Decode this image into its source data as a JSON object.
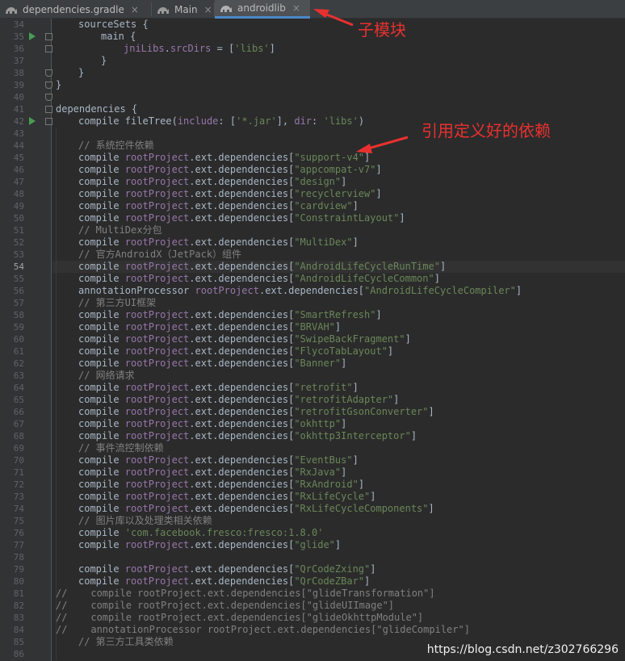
{
  "tabs": [
    {
      "label": "dependencies.gradle",
      "close": "×",
      "active": false
    },
    {
      "label": "Main",
      "close": "×",
      "active": false
    },
    {
      "label": "androidlib",
      "close": "×",
      "active": true
    }
  ],
  "gutter": {
    "line_numbers": [
      "34",
      "35",
      "36",
      "37",
      "38",
      "39",
      "40",
      "41",
      "42",
      "43",
      "44",
      "45",
      "46",
      "47",
      "48",
      "49",
      "50",
      "51",
      "52",
      "53",
      "54",
      "55",
      "56",
      "57",
      "58",
      "59",
      "60",
      "61",
      "62",
      "63",
      "64",
      "65",
      "66",
      "67",
      "68",
      "69",
      "70",
      "71",
      "72",
      "73",
      "74",
      "75",
      "76",
      "77",
      "78",
      "79",
      "80",
      "81",
      "82",
      "83",
      "84",
      "85",
      "86"
    ],
    "current_line": "54"
  },
  "code": [
    {
      "indent": 1,
      "parts": [
        [
          "idc",
          "sourceSets {"
        ]
      ]
    },
    {
      "indent": 2,
      "parts": [
        [
          "idc",
          "main {"
        ]
      ]
    },
    {
      "indent": 3,
      "parts": [
        [
          "prop",
          "jniLibs"
        ],
        [
          "idc",
          "."
        ],
        [
          "prop",
          "srcDirs"
        ],
        [
          "idc",
          " = ["
        ],
        [
          "str",
          "'libs'"
        ],
        [
          "idc",
          "]"
        ]
      ]
    },
    {
      "indent": 2,
      "parts": [
        [
          "idc",
          "}"
        ]
      ]
    },
    {
      "indent": 1,
      "parts": [
        [
          "idc",
          "}"
        ]
      ]
    },
    {
      "indent": 0,
      "parts": [
        [
          "idc",
          "}"
        ]
      ]
    },
    {
      "indent": 0,
      "parts": []
    },
    {
      "indent": 0,
      "parts": [
        [
          "idc",
          "dependencies {"
        ]
      ]
    },
    {
      "indent": 1,
      "parts": [
        [
          "idc",
          "compile fileTree("
        ],
        [
          "prop",
          "include"
        ],
        [
          "idc",
          ": ["
        ],
        [
          "str",
          "'*.jar'"
        ],
        [
          "idc",
          "], "
        ],
        [
          "prop",
          "dir"
        ],
        [
          "idc",
          ": "
        ],
        [
          "str",
          "'libs'"
        ],
        [
          "idc",
          ")"
        ]
      ]
    },
    {
      "indent": 0,
      "parts": []
    },
    {
      "indent": 1,
      "parts": [
        [
          "cmt",
          "// 系统控件依赖"
        ]
      ]
    },
    {
      "indent": 1,
      "parts": [
        [
          "idc",
          "compile "
        ],
        [
          "prop",
          "rootProject"
        ],
        [
          "idc",
          ".ext.dependencies["
        ],
        [
          "str",
          "\"support-v4\""
        ],
        [
          "idc",
          "]"
        ]
      ]
    },
    {
      "indent": 1,
      "parts": [
        [
          "idc",
          "compile "
        ],
        [
          "prop",
          "rootProject"
        ],
        [
          "idc",
          ".ext.dependencies["
        ],
        [
          "str",
          "\"appcompat-v7\""
        ],
        [
          "idc",
          "]"
        ]
      ]
    },
    {
      "indent": 1,
      "parts": [
        [
          "idc",
          "compile "
        ],
        [
          "prop",
          "rootProject"
        ],
        [
          "idc",
          ".ext.dependencies["
        ],
        [
          "str",
          "\"design\""
        ],
        [
          "idc",
          "]"
        ]
      ]
    },
    {
      "indent": 1,
      "parts": [
        [
          "idc",
          "compile "
        ],
        [
          "prop",
          "rootProject"
        ],
        [
          "idc",
          ".ext.dependencies["
        ],
        [
          "str",
          "\"recyclerview\""
        ],
        [
          "idc",
          "]"
        ]
      ]
    },
    {
      "indent": 1,
      "parts": [
        [
          "idc",
          "compile "
        ],
        [
          "prop",
          "rootProject"
        ],
        [
          "idc",
          ".ext.dependencies["
        ],
        [
          "str",
          "\"cardview\""
        ],
        [
          "idc",
          "]"
        ]
      ]
    },
    {
      "indent": 1,
      "parts": [
        [
          "idc",
          "compile "
        ],
        [
          "prop",
          "rootProject"
        ],
        [
          "idc",
          ".ext.dependencies["
        ],
        [
          "str",
          "\"ConstraintLayout\""
        ],
        [
          "idc",
          "]"
        ]
      ]
    },
    {
      "indent": 1,
      "parts": [
        [
          "cmt",
          "// MultiDex分包"
        ]
      ]
    },
    {
      "indent": 1,
      "parts": [
        [
          "idc",
          "compile "
        ],
        [
          "prop",
          "rootProject"
        ],
        [
          "idc",
          ".ext.dependencies["
        ],
        [
          "str",
          "\"MultiDex\""
        ],
        [
          "idc",
          "]"
        ]
      ]
    },
    {
      "indent": 1,
      "parts": [
        [
          "cmt",
          "// 官方AndroidX（JetPack）组件"
        ]
      ]
    },
    {
      "indent": 1,
      "parts": [
        [
          "idc",
          "compile "
        ],
        [
          "prop",
          "rootProject"
        ],
        [
          "idc",
          ".ext.dependencies["
        ],
        [
          "str",
          "\"AndroidLifeCycleRunTime\""
        ],
        [
          "idc",
          "]"
        ]
      ]
    },
    {
      "indent": 1,
      "parts": [
        [
          "idc",
          "compile "
        ],
        [
          "prop",
          "rootProject"
        ],
        [
          "idc",
          ".ext.dependencies["
        ],
        [
          "str",
          "\"AndroidLifeCycleCommon\""
        ],
        [
          "idc",
          "]"
        ]
      ]
    },
    {
      "indent": 1,
      "parts": [
        [
          "idc",
          "annotationProcessor "
        ],
        [
          "prop",
          "rootProject"
        ],
        [
          "idc",
          ".ext.dependencies["
        ],
        [
          "str",
          "\"AndroidLifeCycleCompiler\""
        ],
        [
          "idc",
          "]"
        ]
      ]
    },
    {
      "indent": 1,
      "parts": [
        [
          "cmt",
          "// 第三方UI框架"
        ]
      ]
    },
    {
      "indent": 1,
      "parts": [
        [
          "idc",
          "compile "
        ],
        [
          "prop",
          "rootProject"
        ],
        [
          "idc",
          ".ext.dependencies["
        ],
        [
          "str",
          "\"SmartRefresh\""
        ],
        [
          "idc",
          "]"
        ]
      ]
    },
    {
      "indent": 1,
      "parts": [
        [
          "idc",
          "compile "
        ],
        [
          "prop",
          "rootProject"
        ],
        [
          "idc",
          ".ext.dependencies["
        ],
        [
          "str",
          "\"BRVAH\""
        ],
        [
          "idc",
          "]"
        ]
      ]
    },
    {
      "indent": 1,
      "parts": [
        [
          "idc",
          "compile "
        ],
        [
          "prop",
          "rootProject"
        ],
        [
          "idc",
          ".ext.dependencies["
        ],
        [
          "str",
          "\"SwipeBackFragment\""
        ],
        [
          "idc",
          "]"
        ]
      ]
    },
    {
      "indent": 1,
      "parts": [
        [
          "idc",
          "compile "
        ],
        [
          "prop",
          "rootProject"
        ],
        [
          "idc",
          ".ext.dependencies["
        ],
        [
          "str",
          "\"FlycoTabLayout\""
        ],
        [
          "idc",
          "]"
        ]
      ]
    },
    {
      "indent": 1,
      "parts": [
        [
          "idc",
          "compile "
        ],
        [
          "prop",
          "rootProject"
        ],
        [
          "idc",
          ".ext.dependencies["
        ],
        [
          "str",
          "\"Banner\""
        ],
        [
          "idc",
          "]"
        ]
      ]
    },
    {
      "indent": 1,
      "parts": [
        [
          "cmt",
          "// 网络请求"
        ]
      ]
    },
    {
      "indent": 1,
      "parts": [
        [
          "idc",
          "compile "
        ],
        [
          "prop",
          "rootProject"
        ],
        [
          "idc",
          ".ext.dependencies["
        ],
        [
          "str",
          "\"retrofit\""
        ],
        [
          "idc",
          "]"
        ]
      ]
    },
    {
      "indent": 1,
      "parts": [
        [
          "idc",
          "compile "
        ],
        [
          "prop",
          "rootProject"
        ],
        [
          "idc",
          ".ext.dependencies["
        ],
        [
          "str",
          "\"retrofitAdapter\""
        ],
        [
          "idc",
          "]"
        ]
      ]
    },
    {
      "indent": 1,
      "parts": [
        [
          "idc",
          "compile "
        ],
        [
          "prop",
          "rootProject"
        ],
        [
          "idc",
          ".ext.dependencies["
        ],
        [
          "str",
          "\"retrofitGsonConverter\""
        ],
        [
          "idc",
          "]"
        ]
      ]
    },
    {
      "indent": 1,
      "parts": [
        [
          "idc",
          "compile "
        ],
        [
          "prop",
          "rootProject"
        ],
        [
          "idc",
          ".ext.dependencies["
        ],
        [
          "str",
          "\"okhttp\""
        ],
        [
          "idc",
          "]"
        ]
      ]
    },
    {
      "indent": 1,
      "parts": [
        [
          "idc",
          "compile "
        ],
        [
          "prop",
          "rootProject"
        ],
        [
          "idc",
          ".ext.dependencies["
        ],
        [
          "str",
          "\"okhttp3Interceptor\""
        ],
        [
          "idc",
          "]"
        ]
      ]
    },
    {
      "indent": 1,
      "parts": [
        [
          "cmt",
          "// 事件流控制依赖"
        ]
      ]
    },
    {
      "indent": 1,
      "parts": [
        [
          "idc",
          "compile "
        ],
        [
          "prop",
          "rootProject"
        ],
        [
          "idc",
          ".ext.dependencies["
        ],
        [
          "str",
          "\"EventBus\""
        ],
        [
          "idc",
          "]"
        ]
      ]
    },
    {
      "indent": 1,
      "parts": [
        [
          "idc",
          "compile "
        ],
        [
          "prop",
          "rootProject"
        ],
        [
          "idc",
          ".ext.dependencies["
        ],
        [
          "str",
          "\"RxJava\""
        ],
        [
          "idc",
          "]"
        ]
      ]
    },
    {
      "indent": 1,
      "parts": [
        [
          "idc",
          "compile "
        ],
        [
          "prop",
          "rootProject"
        ],
        [
          "idc",
          ".ext.dependencies["
        ],
        [
          "str",
          "\"RxAndroid\""
        ],
        [
          "idc",
          "]"
        ]
      ]
    },
    {
      "indent": 1,
      "parts": [
        [
          "idc",
          "compile "
        ],
        [
          "prop",
          "rootProject"
        ],
        [
          "idc",
          ".ext.dependencies["
        ],
        [
          "str",
          "\"RxLifeCycle\""
        ],
        [
          "idc",
          "]"
        ]
      ]
    },
    {
      "indent": 1,
      "parts": [
        [
          "idc",
          "compile "
        ],
        [
          "prop",
          "rootProject"
        ],
        [
          "idc",
          ".ext.dependencies["
        ],
        [
          "str",
          "\"RxLifeCycleComponents\""
        ],
        [
          "idc",
          "]"
        ]
      ]
    },
    {
      "indent": 1,
      "parts": [
        [
          "cmt",
          "// 图片库以及处理类相关依赖"
        ]
      ]
    },
    {
      "indent": 1,
      "parts": [
        [
          "idc",
          "compile "
        ],
        [
          "str",
          "'com.facebook.fresco:fresco:1.8.0'"
        ]
      ]
    },
    {
      "indent": 1,
      "parts": [
        [
          "idc",
          "compile "
        ],
        [
          "prop",
          "rootProject"
        ],
        [
          "idc",
          ".ext.dependencies["
        ],
        [
          "str",
          "\"glide\""
        ],
        [
          "idc",
          "]"
        ]
      ]
    },
    {
      "indent": 0,
      "parts": []
    },
    {
      "indent": 1,
      "parts": [
        [
          "idc",
          "compile "
        ],
        [
          "prop",
          "rootProject"
        ],
        [
          "idc",
          ".ext.dependencies["
        ],
        [
          "str",
          "\"QrCodeZxing\""
        ],
        [
          "idc",
          "]"
        ]
      ]
    },
    {
      "indent": 1,
      "parts": [
        [
          "idc",
          "compile "
        ],
        [
          "prop",
          "rootProject"
        ],
        [
          "idc",
          ".ext.dependencies["
        ],
        [
          "str",
          "\"QrCodeZBar\""
        ],
        [
          "idc",
          "]"
        ]
      ]
    },
    {
      "indent": 0,
      "parts": [
        [
          "cmt",
          "//    compile rootProject.ext.dependencies[\"glideTransformation\"]"
        ]
      ]
    },
    {
      "indent": 0,
      "parts": [
        [
          "cmt",
          "//    compile rootProject.ext.dependencies[\"glideUIImage\"]"
        ]
      ]
    },
    {
      "indent": 0,
      "parts": [
        [
          "cmt",
          "//    compile rootProject.ext.dependencies[\"glideOkhttpModule\"]"
        ]
      ]
    },
    {
      "indent": 0,
      "parts": [
        [
          "cmt",
          "//    annotationProcessor rootProject.ext.dependencies[\"glideCompiler\"]"
        ]
      ]
    },
    {
      "indent": 1,
      "parts": [
        [
          "cmt",
          "// 第三方工具类依赖"
        ]
      ]
    }
  ],
  "annotations": {
    "submodule_label": "子模块",
    "reference_label": "引用定义好的依赖",
    "arrow_color": "#e8312f"
  },
  "watermark": "https://blog.csdn.net/z302766296",
  "colors": {
    "keyword": "#cc7832",
    "string": "#6a8759",
    "property": "#9876aa",
    "comment": "#808080",
    "text": "#a9b7c6",
    "background": "#2b2b2b",
    "run_icon": "#499c54",
    "active_tab_underline": "#4a88c7"
  }
}
